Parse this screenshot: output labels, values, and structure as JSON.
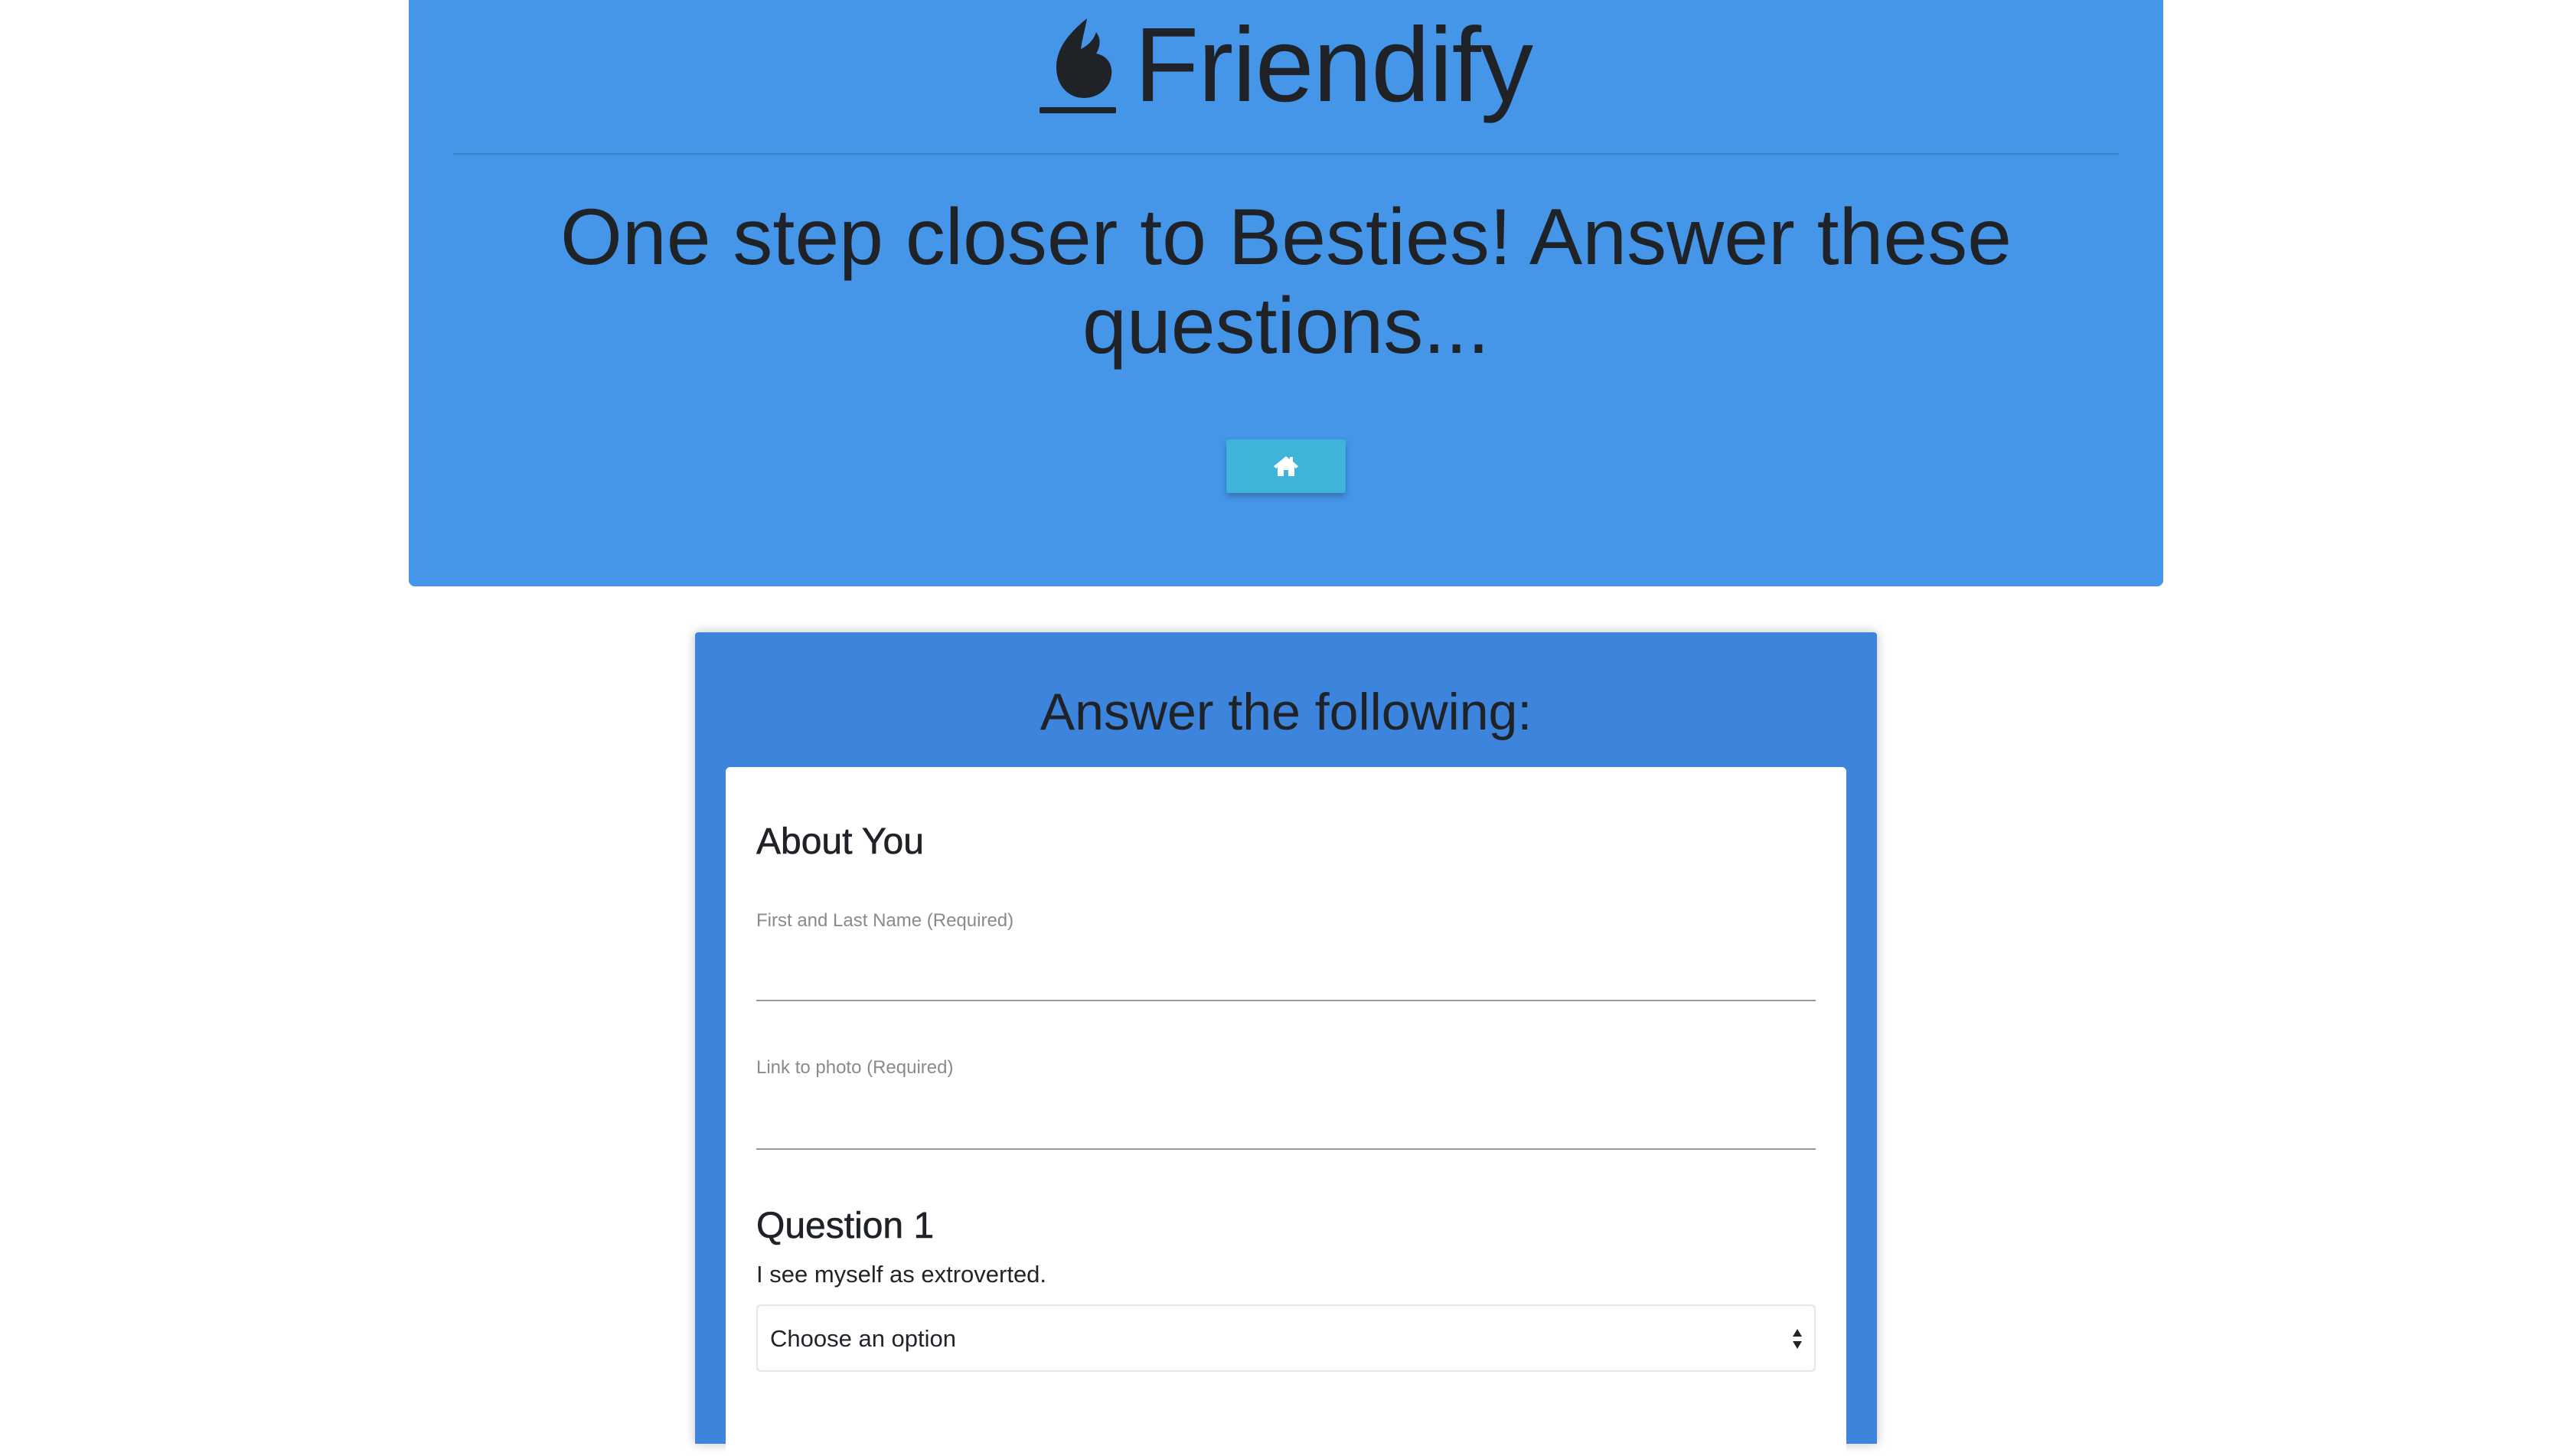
{
  "header": {
    "brand_name": "Friendify",
    "logo_icon": "flame-logo-icon",
    "heading": "One step closer to Besties! Answer these questions...",
    "home_button_icon": "home-icon"
  },
  "form": {
    "title": "Answer the following:",
    "about_section": {
      "title": "About You",
      "name_label": "First and Last Name (Required)",
      "name_value": "",
      "photo_label": "Link to photo (Required)",
      "photo_value": ""
    },
    "question_1": {
      "title": "Question 1",
      "text": "I see myself as extroverted.",
      "selected_option": "Choose an option",
      "select_icon": "select-arrows-icon"
    }
  },
  "colors": {
    "hero_bg": "#4596e8",
    "panel_bg": "#3d85dc",
    "home_button_bg": "#3fb3d8",
    "text_dark": "#1f2328"
  }
}
